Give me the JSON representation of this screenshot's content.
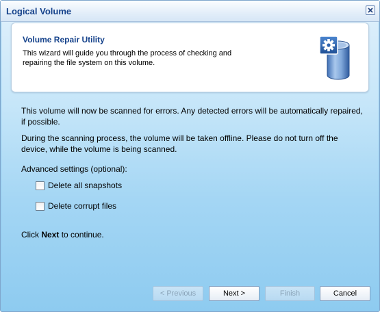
{
  "window": {
    "title": "Logical Volume"
  },
  "header": {
    "title": "Volume Repair Utility",
    "description": "This wizard will guide you through the process of checking and repairing the file system on this volume.",
    "icon": "volume-gear-icon"
  },
  "body": {
    "para1": "This volume will now be scanned for errors. Any detected errors will be automatically repaired, if possible.",
    "para2": "During the scanning process, the volume will be taken offline. Please do not turn off the device, while the volume is being scanned.",
    "advanced_label": "Advanced settings (optional):",
    "options": [
      {
        "label": "Delete all snapshots",
        "checked": false
      },
      {
        "label": "Delete corrupt files",
        "checked": false
      }
    ],
    "continue_prefix": "Click ",
    "continue_bold": "Next",
    "continue_suffix": " to continue."
  },
  "buttons": {
    "previous": "< Previous",
    "next": "Next >",
    "finish": "Finish",
    "cancel": "Cancel"
  },
  "colors": {
    "title": "#15428b",
    "background": "#8ecbf0"
  }
}
